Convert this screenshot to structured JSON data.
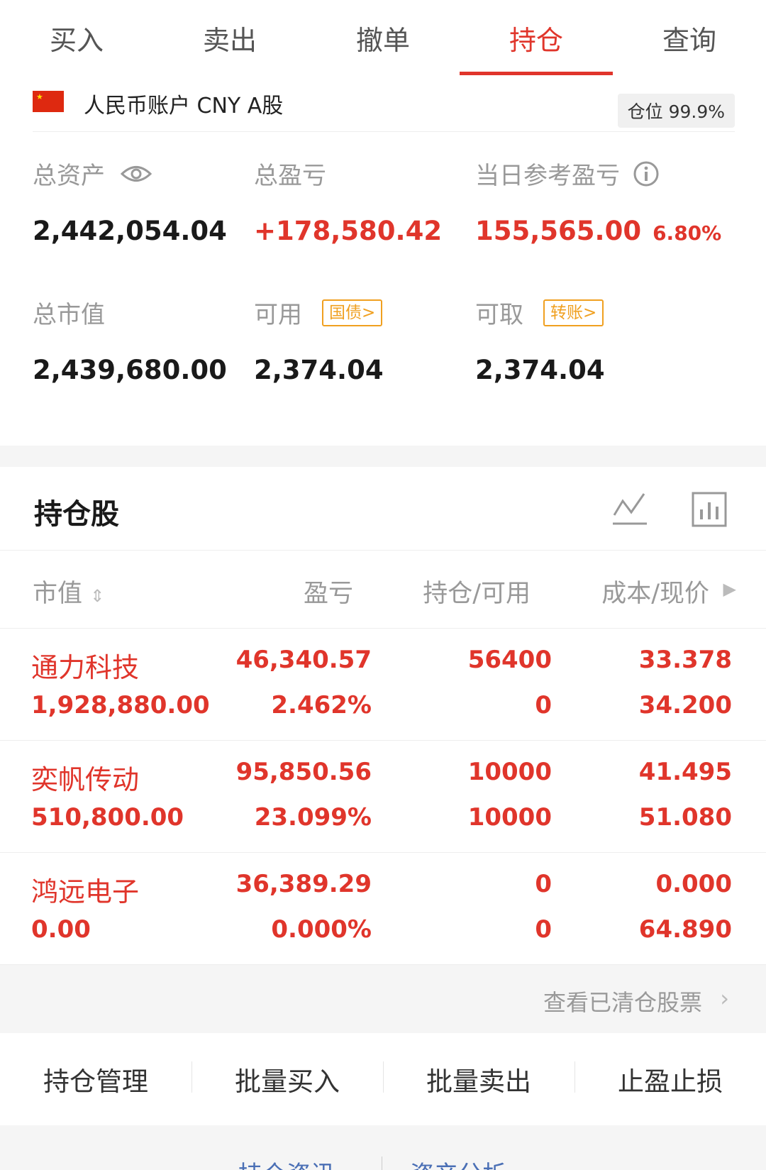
{
  "tabs": [
    "买入",
    "卖出",
    "撤单",
    "持仓",
    "查询"
  ],
  "active_tab": "持仓",
  "account": {
    "name": "人民币账户 CNY A股",
    "position_label": "仓位 99.9%"
  },
  "summary": {
    "total_assets_label": "总资产",
    "total_assets": "2,442,054.04",
    "total_pnl_label": "总盈亏",
    "total_pnl": "+178,580.42",
    "today_pnl_label": "当日参考盈亏",
    "today_pnl": "155,565.00",
    "today_pnl_pct": "6.80%",
    "market_value_label": "总市值",
    "market_value": "2,439,680.00",
    "available_label": "可用",
    "available_tag": "国债>",
    "available": "2,374.04",
    "withdrawable_label": "可取",
    "withdrawable_tag": "转账>",
    "withdrawable": "2,374.04"
  },
  "holdings": {
    "title": "持仓股",
    "columns": [
      "市值",
      "盈亏",
      "持仓/可用",
      "成本/现价"
    ],
    "rows": [
      {
        "name": "通力科技",
        "market_value": "1,928,880.00",
        "pnl": "46,340.57",
        "pnl_pct": "2.462%",
        "position": "56400",
        "available": "0",
        "cost": "33.378",
        "price": "34.200"
      },
      {
        "name": "奕帆传动",
        "market_value": "510,800.00",
        "pnl": "95,850.56",
        "pnl_pct": "23.099%",
        "position": "10000",
        "available": "10000",
        "cost": "41.495",
        "price": "51.080"
      },
      {
        "name": "鸿远电子",
        "market_value": "0.00",
        "pnl": "36,389.29",
        "pnl_pct": "0.000%",
        "position": "0",
        "available": "0",
        "cost": "0.000",
        "price": "64.890"
      }
    ]
  },
  "cleared_link": "查看已清仓股票",
  "actions": [
    "持仓管理",
    "批量买入",
    "批量卖出",
    "止盈止损"
  ],
  "bottom_links": [
    "持仓资讯",
    "资产分析"
  ],
  "colors": {
    "accent_red": "#e0352b",
    "tag_orange": "#f0a020",
    "muted_gray": "#999999"
  }
}
